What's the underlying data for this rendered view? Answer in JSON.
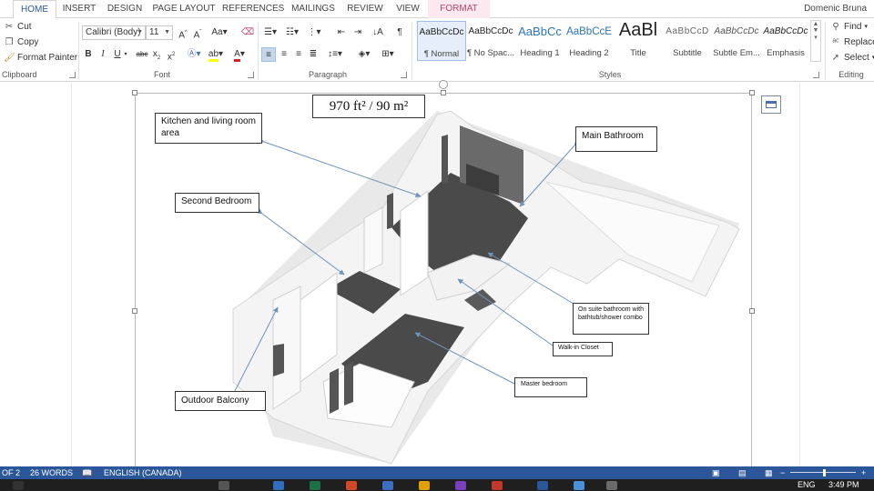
{
  "tabs": [
    {
      "label": "HOME",
      "active": true
    },
    {
      "label": "INSERT"
    },
    {
      "label": "DESIGN"
    },
    {
      "label": "PAGE LAYOUT"
    },
    {
      "label": "REFERENCES"
    },
    {
      "label": "MAILINGS"
    },
    {
      "label": "REVIEW"
    },
    {
      "label": "VIEW"
    },
    {
      "label": "FORMAT",
      "contextual": true
    }
  ],
  "user": "Domenic Bruna",
  "clipboard": {
    "cut": "Cut",
    "copy": "Copy",
    "format_painter": "Format Painter",
    "label": "Clipboard"
  },
  "font": {
    "family": "Calibri (Body)",
    "size": "11",
    "label": "Font"
  },
  "paragraph": {
    "label": "Paragraph"
  },
  "styles": {
    "label": "Styles",
    "items": [
      {
        "sample": "AaBbCcDc",
        "name": "¶ Normal",
        "selected": true
      },
      {
        "sample": "AaBbCcDc",
        "name": "¶ No Spac..."
      },
      {
        "sample": "AaBbCc",
        "name": "Heading 1"
      },
      {
        "sample": "AaBbCcE",
        "name": "Heading 2"
      },
      {
        "sample": "AaBl",
        "name": "Title"
      },
      {
        "sample": "AaBbCcD",
        "name": "Subtitle"
      },
      {
        "sample": "AaBbCcDc",
        "name": "Subtle Em..."
      },
      {
        "sample": "AaBbCcDc",
        "name": "Emphasis"
      }
    ]
  },
  "editing": {
    "find": "Find",
    "replace": "Replace",
    "select": "Select",
    "label": "Editing"
  },
  "floorplan": {
    "area": "970 ft² / 90 m²",
    "labels": {
      "kitchen": "Kitchen and living room area",
      "main_bath": "Main Bathroom",
      "second_bed": "Second Bedroom",
      "ensuite": "On suite bathroom with bathtub/shower combo",
      "closet": "Walk-in Closet",
      "master": "Master bedroom",
      "balcony": "Outdoor Balcony"
    }
  },
  "status": {
    "page": "OF 2",
    "words": "26 WORDS",
    "language": "ENGLISH (CANADA)"
  },
  "taskbar": {
    "lang": "ENG",
    "time": "3:49 PM"
  },
  "colors": {
    "accent": "#2b579a",
    "contextual_tab": "#b4456b",
    "floor": "#4a4a4a",
    "arrow": "#6f93b8"
  }
}
